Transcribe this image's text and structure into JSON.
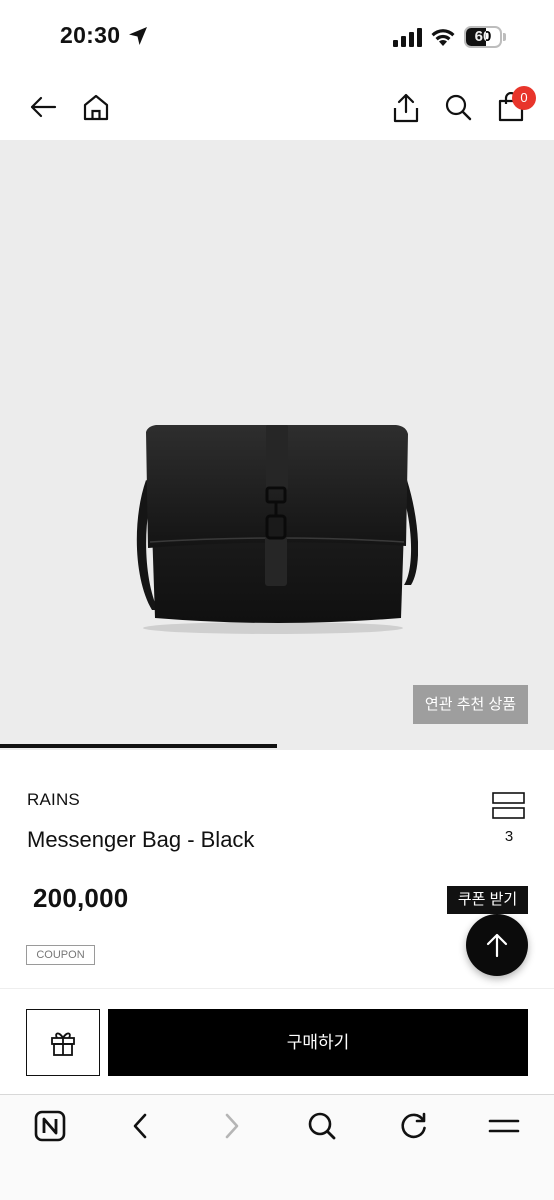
{
  "status_bar": {
    "time": "20:30",
    "battery": "60",
    "battery_level": 0.6
  },
  "top_nav": {
    "cart_count": "0"
  },
  "hero": {
    "related_label": "연관 추천 상품",
    "slide_progress": 0.5
  },
  "product": {
    "brand": "RAINS",
    "name": "Messenger Bag - Black",
    "option_count": "3",
    "price": "200,000",
    "coupon_button": "쿠폰 받기",
    "coupon_tag": "COUPON"
  },
  "purchase_bar": {
    "buy_label": "구매하기"
  },
  "icons": {
    "status": [
      "location-arrow-icon",
      "signal-icon",
      "wifi-icon",
      "battery-icon"
    ],
    "top_nav": [
      "back-arrow-icon",
      "home-icon",
      "share-icon",
      "search-icon",
      "cart-icon"
    ],
    "product": [
      "option-layers-icon",
      "arrow-up-icon",
      "gift-icon"
    ],
    "toolbar": [
      "naver-n-icon",
      "chevron-left-icon",
      "chevron-right-icon",
      "search-icon",
      "refresh-icon",
      "menu-icon"
    ]
  },
  "colors": {
    "badge": "#e8352b",
    "primary": "#000000",
    "hero_background": "#ececec",
    "related_button": "#9e9e9e"
  }
}
